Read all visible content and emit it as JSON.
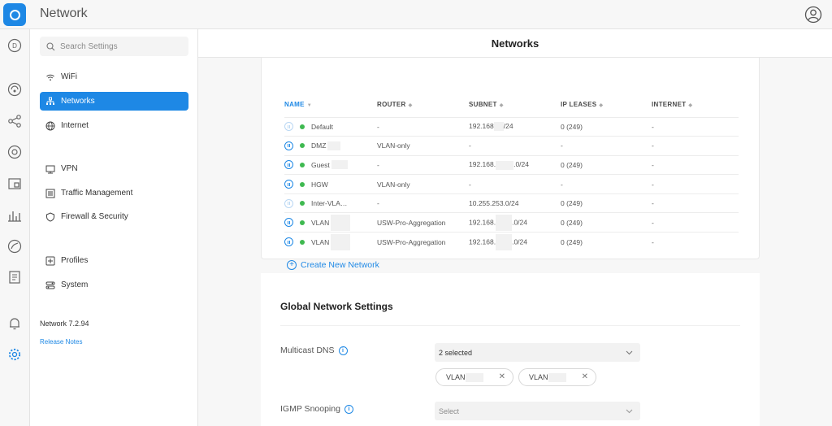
{
  "app": {
    "title": "Network"
  },
  "rail": [
    "dashboard-icon",
    "topology-icon",
    "network-topology-icon",
    "clients-icon",
    "devices-icon",
    "statistics-icon",
    "insights-icon",
    "logs-icon",
    "alerts-icon",
    "settings-icon"
  ],
  "nav": {
    "search_placeholder": "Search Settings",
    "items": [
      {
        "label": "WiFi",
        "icon": "wifi-icon"
      },
      {
        "label": "Networks",
        "icon": "networks-icon",
        "active": true
      },
      {
        "label": "Internet",
        "icon": "globe-icon"
      },
      {
        "label": "VPN",
        "icon": "vpn-icon"
      },
      {
        "label": "Traffic Management",
        "icon": "traffic-icon"
      },
      {
        "label": "Firewall & Security",
        "icon": "shield-icon"
      },
      {
        "label": "Profiles",
        "icon": "profiles-icon"
      },
      {
        "label": "System",
        "icon": "system-icon"
      }
    ],
    "version": "Network 7.2.94",
    "release_notes": "Release Notes"
  },
  "main": {
    "title": "Networks",
    "table": {
      "headers": [
        "NAME",
        "ROUTER",
        "SUBNET",
        "IP LEASES",
        "INTERNET"
      ],
      "rows": [
        {
          "name": "Default",
          "router": "-",
          "subnet_a": "192.168",
          "subnet_b": "/24",
          "leases": "0 (249)",
          "internet": "-",
          "icon_faint": true
        },
        {
          "name": "DMZ",
          "router": "VLAN-only",
          "subnet_a": "-",
          "subnet_b": "",
          "leases": "-",
          "internet": "-",
          "icon_faint": false
        },
        {
          "name": "Guest",
          "router": "-",
          "subnet_a": "192.168.",
          "subnet_b": ".0/24",
          "leases": "0 (249)",
          "internet": "-",
          "icon_faint": false
        },
        {
          "name": "HGW",
          "router": "VLAN-only",
          "subnet_a": "-",
          "subnet_b": "",
          "leases": "-",
          "internet": "-",
          "icon_faint": false
        },
        {
          "name": "Inter-VLA…",
          "router": "-",
          "subnet_a": "10.255.253.0/24",
          "subnet_b": "",
          "leases": "0 (249)",
          "internet": "-",
          "icon_faint": true
        },
        {
          "name": "VLAN",
          "router": "USW-Pro-Aggregation",
          "subnet_a": "192.168.",
          "subnet_b": ".0/24",
          "leases": "0 (249)",
          "internet": "-",
          "icon_faint": false
        },
        {
          "name": "VLAN",
          "router": "USW-Pro-Aggregation",
          "subnet_a": "192.168.",
          "subnet_b": ".0/24",
          "leases": "0 (249)",
          "internet": "-",
          "icon_faint": false
        }
      ]
    },
    "create_label": "Create New Network",
    "global": {
      "title": "Global Network Settings",
      "multicast_label": "Multicast DNS",
      "multicast_value": "2 selected",
      "chips": [
        "VLAN",
        "VLAN"
      ],
      "igmp_label": "IGMP Snooping",
      "igmp_placeholder": "Select"
    }
  },
  "colors": {
    "accent": "#1e88e5",
    "status_ok": "#3fb950"
  }
}
